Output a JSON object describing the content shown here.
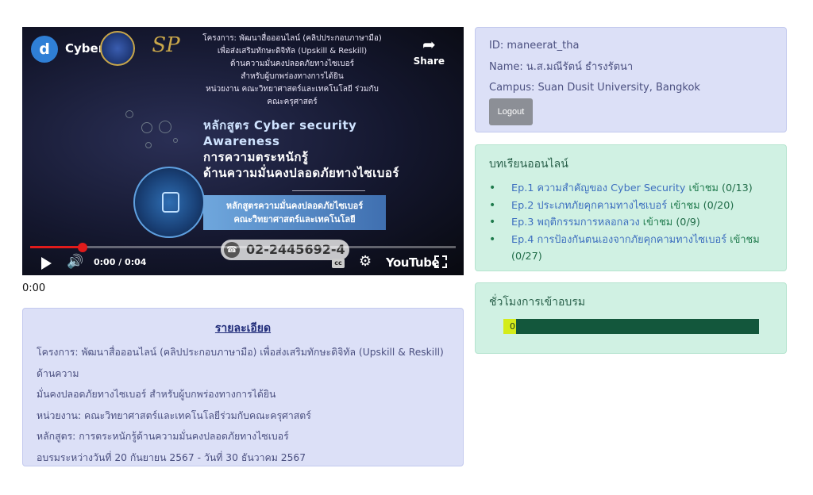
{
  "video": {
    "channel_initial": "d",
    "channel_name": "Cyber",
    "share_label": "Share",
    "heading_lines": [
      "โครงการ: พัฒนาสื่อออนไลน์ (คลิปประกอบภาษามือ)",
      "เพื่อส่งเสริมทักษะดิจิทัล (Upskill & Reskill)",
      "ด้านความมั่นคงปลอดภัยทางไซเบอร์",
      "สำหรับผู้บกพร่องทางการได้ยิน",
      "หน่วยงาน คณะวิทยาศาสตร์และเทคโนโลยี ร่วมกับ",
      "คณะครุศาสตร์"
    ],
    "course_lines": [
      "หลักสูตร Cyber security",
      "Awareness",
      "การความตระหนักรู้",
      "ด้านความมั่นคงปลอดภัยทางไซเบอร์"
    ],
    "box_lines": [
      "หลักสูตรความมั่นคงปลอดภัยไซเบอร์",
      "คณะวิทยาศาสตร์และเทคโนโลยี"
    ],
    "phone": "02-2445692-4",
    "time_display": "0:00 / 0:04",
    "cc_label": "cc",
    "brand": "YouTube",
    "played_fraction": 0.124
  },
  "time_below": "0:00",
  "details": {
    "title": "รายละเอียด",
    "lines": [
      "โครงการ: พัฒนาสื่อออนไลน์ (คลิปประกอบภาษามือ) เพื่อส่งเสริมทักษะดิจิทัล (Upskill & Reskill) ด้านความ",
      "มั่นคงปลอดภัยทางไซเบอร์ สำหรับผู้บกพร่องทางการได้ยิน",
      "หน่วยงาน: คณะวิทยาศาสตร์และเทคโนโลยีร่วมกับคณะครุศาสตร์",
      "หลักสูตร: การตระหนักรู้ด้านความมั่นคงปลอดภัยทางไซเบอร์",
      "อบรมระหว่างวันที่ 20 กันยายน 2567 - วันที่ 30 ธันวาคม 2567"
    ]
  },
  "user": {
    "id_line": "ID: maneerat_tha",
    "name_line": "Name: น.ส.มณีรัตน์ ธำรงรัตนา",
    "campus_line": "Campus: Suan Dusit University, Bangkok",
    "logout_label": "Logout"
  },
  "lessons": {
    "heading": "บทเรียนออนไลน์",
    "items": [
      {
        "title": "Ep.1 ความสำคัญของ Cyber Security",
        "watch": "เข้าชม",
        "progress": "(0/13)"
      },
      {
        "title": "Ep.2 ประเภทภัยคุกคามทางไซเบอร์",
        "watch": "เข้าชม",
        "progress": "(0/20)"
      },
      {
        "title": "Ep.3 พฤติกรรมการหลอกลวง",
        "watch": "เข้าชม",
        "progress": "(0/9)"
      },
      {
        "title": "Ep.4 การป้องกันตนเองจากภัยคุกคามทางไซเบอร์",
        "watch": "เข้าชม",
        "progress": "(0/27)"
      }
    ]
  },
  "hours": {
    "heading": "ชั่วโมงการเข้าอบรม",
    "value_label": "0",
    "fraction": 0.05
  },
  "colors": {
    "accent_blue": "#3d6fbf",
    "watch_green": "#1e7a4c",
    "bar_dark": "#13573c",
    "bar_fill": "#d4ec1a",
    "video_progress": "#e01b1b"
  }
}
